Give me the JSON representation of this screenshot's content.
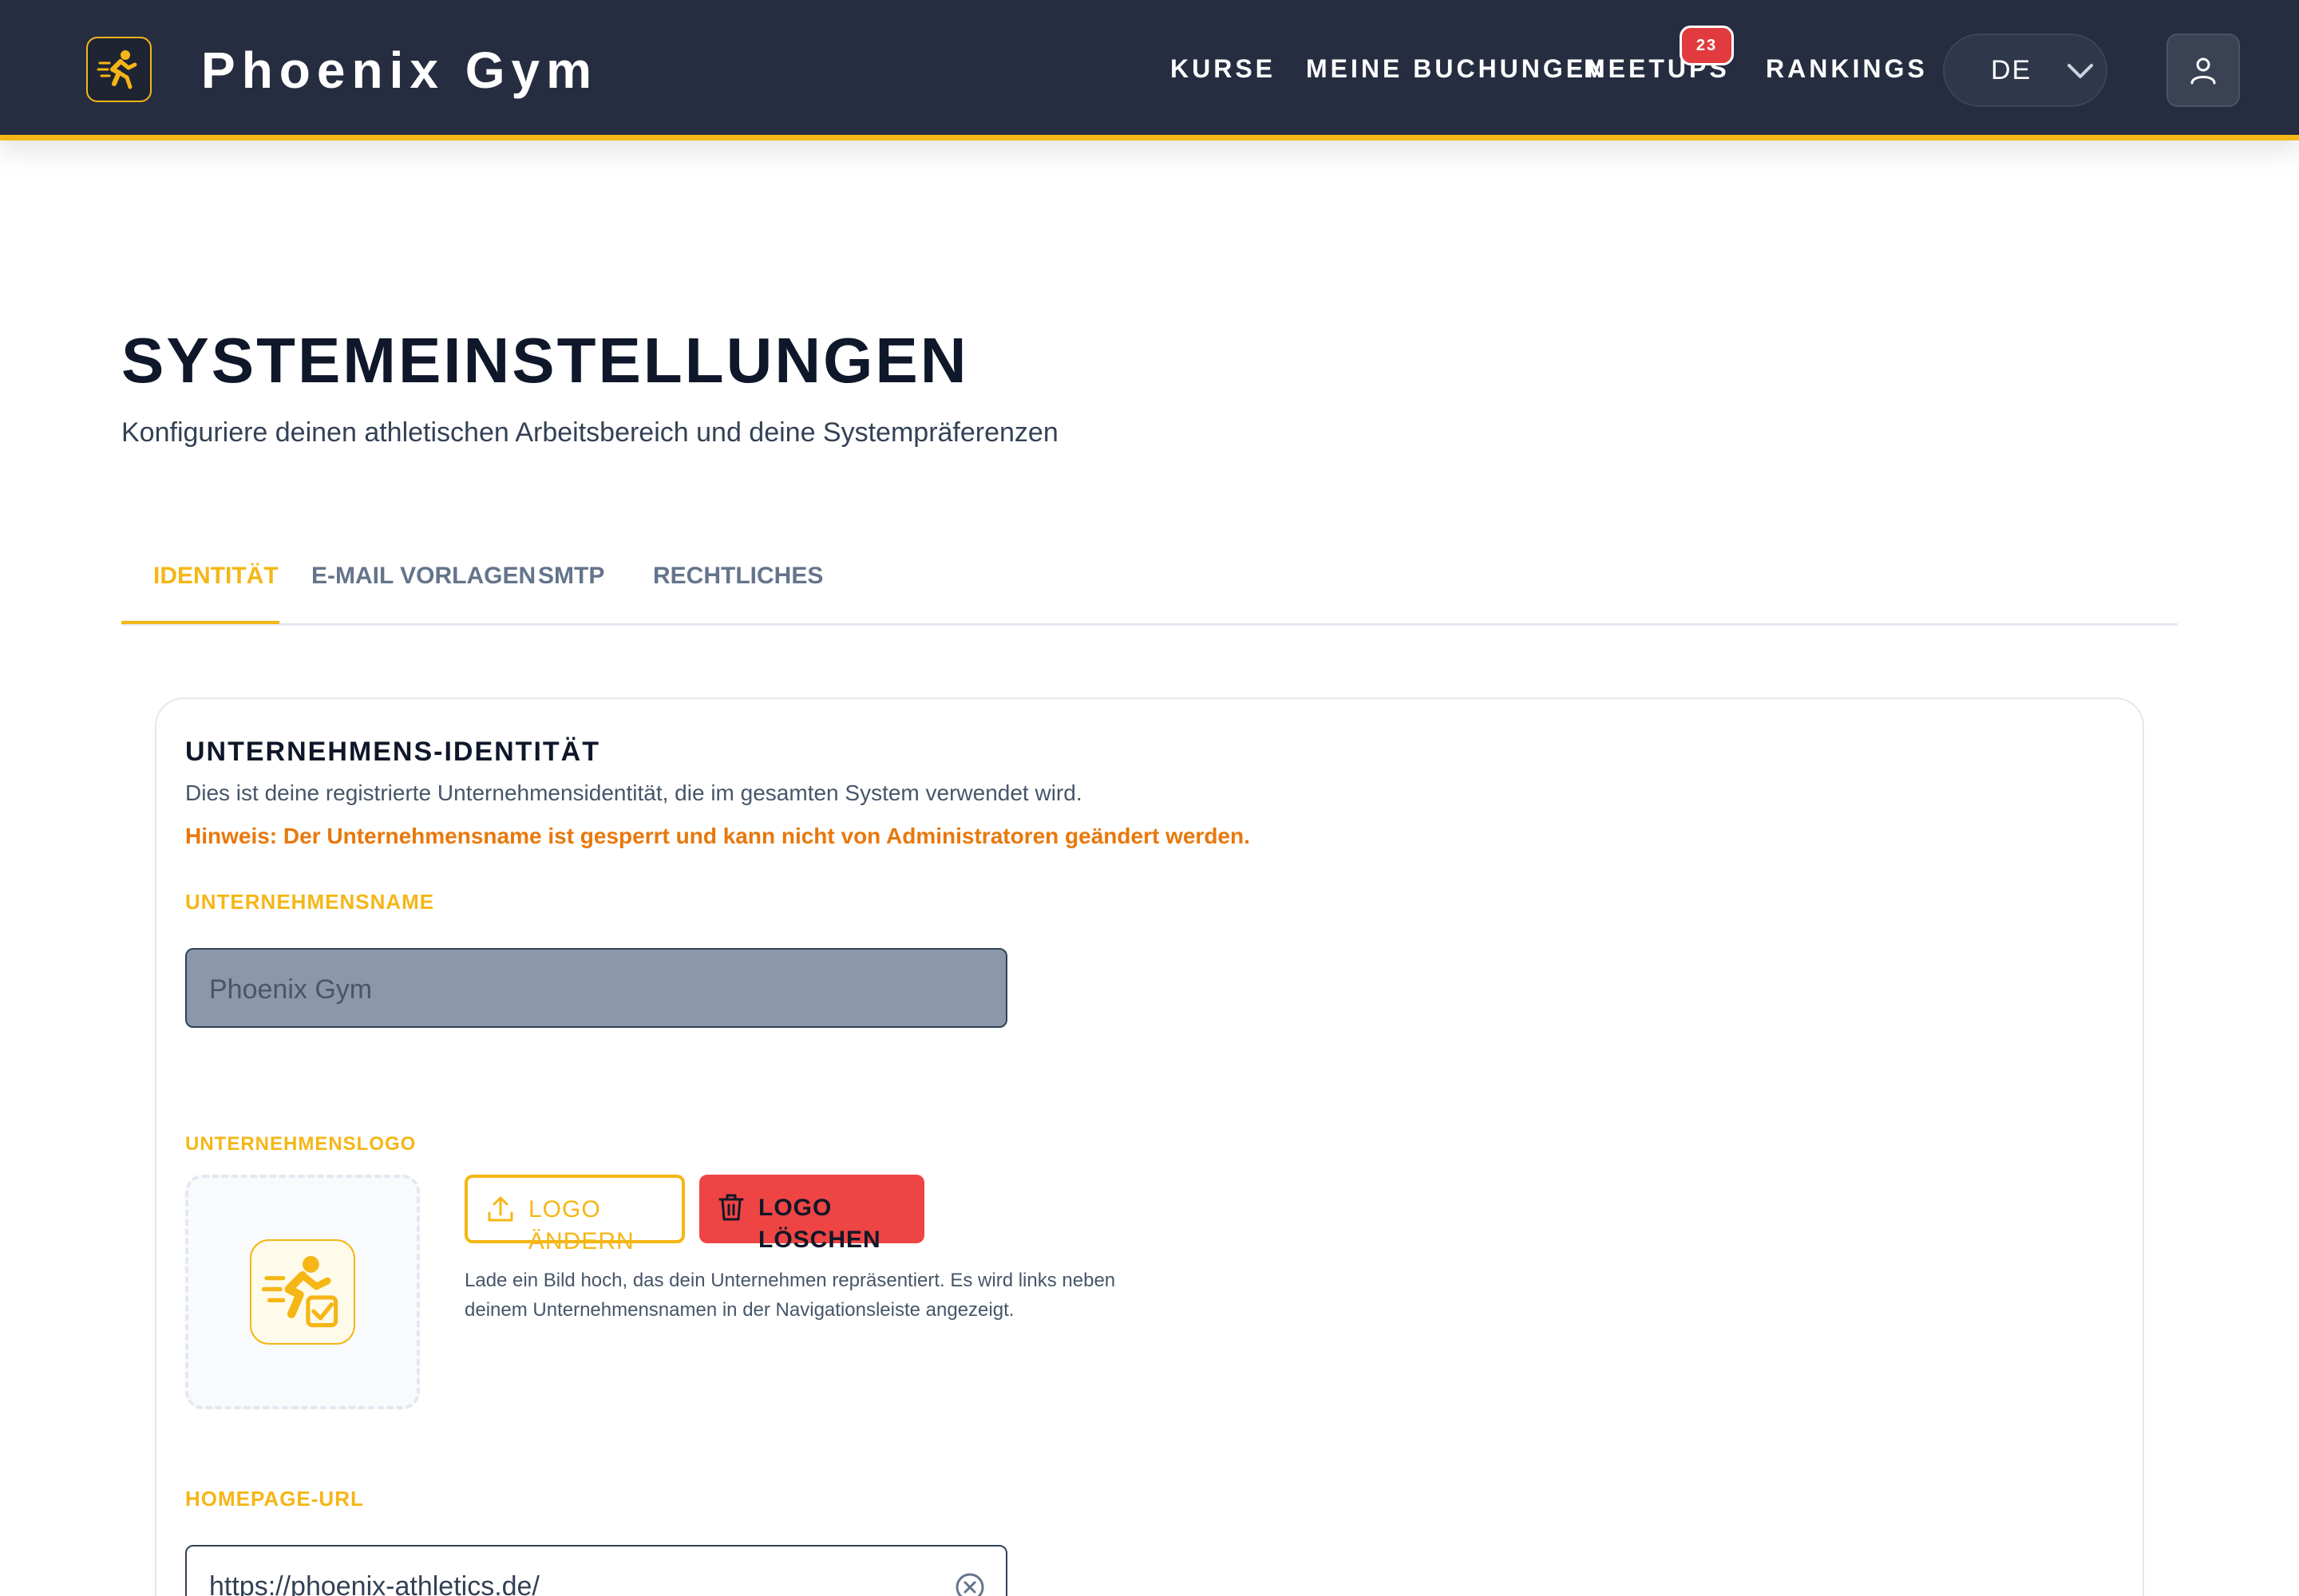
{
  "colors": {
    "accent": "#f5b616",
    "header_bg": "#262d40",
    "danger": "#ef4444",
    "hint": "#e8780b",
    "locked_input": "#8b97ab"
  },
  "header": {
    "brand_name": "Phoenix Gym",
    "brand_logo_icon": "running-athlete-logo-icon",
    "nav": [
      {
        "label": "KURSE"
      },
      {
        "label": "MEINE BUCHUNGEN"
      },
      {
        "label": "MEETUPS",
        "badge": "23"
      },
      {
        "label": "RANKINGS"
      }
    ],
    "language": {
      "code": "DE",
      "icon": "chevron-down-icon"
    },
    "user_icon": "user-icon"
  },
  "page": {
    "title": "SYSTEMEINSTELLUNGEN",
    "subtitle": "Konfiguriere deinen athletischen Arbeitsbereich und deine Systempräferenzen"
  },
  "tabs": [
    {
      "label": "IDENTITÄT",
      "active": true
    },
    {
      "label": "E-MAIL VORLAGEN"
    },
    {
      "label": "SMTP"
    },
    {
      "label": "RECHTLICHES"
    }
  ],
  "identity": {
    "title": "UNTERNEHMENS-IDENTITÄT",
    "description": "Dies ist deine registrierte Unternehmensidentität, die im gesamten System verwendet wird.",
    "hint": "Hinweis: Der Unternehmensname ist gesperrt und kann nicht von Administratoren geändert werden.",
    "company_name": {
      "label": "UNTERNEHMENSNAME",
      "value": "Phoenix Gym",
      "locked": true
    },
    "company_logo": {
      "label": "UNTERNEHMENSLOGO",
      "change_label": "LOGO ÄNDERN",
      "change_icon": "upload-icon",
      "delete_label": "LOGO LÖSCHEN",
      "delete_icon": "trash-icon",
      "help": "Lade ein Bild hoch, das dein Unternehmen repräsentiert. Es wird links neben deinem Unternehmensnamen in der Navigationsleiste angezeigt."
    },
    "homepage": {
      "label": "HOMEPAGE-URL",
      "value": "https://phoenix-athletics.de/",
      "clear_icon": "clear-circle-icon"
    }
  }
}
